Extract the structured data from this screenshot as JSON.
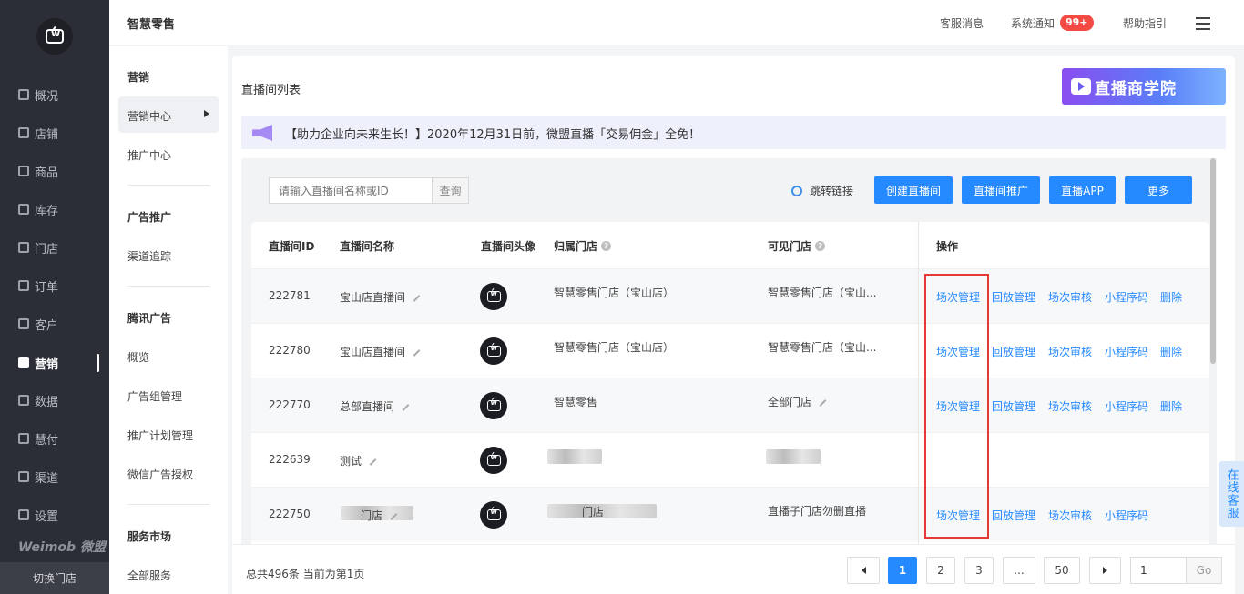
{
  "sidebar": {
    "items": [
      {
        "label": "概况",
        "icon": "overview-icon"
      },
      {
        "label": "店铺",
        "icon": "store-icon"
      },
      {
        "label": "商品",
        "icon": "goods-icon"
      },
      {
        "label": "库存",
        "icon": "inventory-icon"
      },
      {
        "label": "门店",
        "icon": "shop-icon"
      },
      {
        "label": "订单",
        "icon": "order-icon"
      },
      {
        "label": "客户",
        "icon": "customer-icon"
      },
      {
        "label": "营销",
        "icon": "marketing-icon",
        "active": true
      },
      {
        "label": "数据",
        "icon": "data-icon"
      },
      {
        "label": "慧付",
        "icon": "pay-icon"
      },
      {
        "label": "渠道",
        "icon": "channel-icon"
      },
      {
        "label": "设置",
        "icon": "settings-icon"
      }
    ],
    "brand": "Weimob 微盟",
    "switch_store": "切换门店"
  },
  "header": {
    "title": "智慧零售",
    "links": [
      "客服消息",
      "系统通知",
      "帮助指引"
    ],
    "badge": "99+"
  },
  "submenu": {
    "sections": [
      {
        "head": "营销",
        "items": [
          "营销中心",
          "推广中心"
        ]
      },
      {
        "head": "广告推广",
        "items": [
          "渠道追踪"
        ]
      },
      {
        "head": "腾讯广告",
        "items": [
          "概览",
          "广告组管理",
          "推广计划管理",
          "微信广告授权"
        ]
      },
      {
        "head": "服务市场",
        "items": [
          "全部服务"
        ]
      }
    ]
  },
  "main": {
    "title": "直播间列表",
    "banner_ad": "直播商学院",
    "notice": "【助力企业向未来生长！】2020年12月31日前，微盟直播「交易佣金」全免！",
    "search": {
      "placeholder": "请输入直播间名称或ID",
      "button": "查询"
    },
    "jump_link": "跳转链接",
    "buttons": [
      "创建直播间",
      "直播间推广",
      "直播APP",
      "更多"
    ],
    "columns": [
      "直播间ID",
      "直播间名称",
      "直播间头像",
      "归属门店",
      "可见门店",
      "操作"
    ],
    "rows": [
      {
        "id": "222781",
        "name": "宝山店直播间",
        "store": "智慧零售门店（宝山店）",
        "visible": "智慧零售门店（宝山...",
        "ops": [
          "场次管理",
          "回放管理",
          "场次审核",
          "小程序码",
          "删除"
        ]
      },
      {
        "id": "222780",
        "name": "宝山店直播间",
        "store": "智慧零售门店（宝山店）",
        "visible": "智慧零售门店（宝山...",
        "ops": [
          "场次管理",
          "回放管理",
          "场次审核",
          "小程序码",
          "删除"
        ]
      },
      {
        "id": "222770",
        "name": "总部直播间",
        "store": "智慧零售",
        "visible": "全部门店",
        "ops": [
          "场次管理",
          "回放管理",
          "场次审核",
          "小程序码",
          "删除"
        ]
      },
      {
        "id": "222639",
        "name": "测试",
        "store": "",
        "visible": "",
        "ops": []
      },
      {
        "id": "222750",
        "name": "门店",
        "store": "门店",
        "visible": "直播子门店勿删直播",
        "ops": [
          "场次管理",
          "回放管理",
          "场次审核",
          "小程序码"
        ]
      }
    ]
  },
  "pagination": {
    "summary": "总共496条 当前为第1页",
    "pages": [
      "1",
      "2",
      "3",
      "...",
      "50"
    ],
    "current": "1",
    "input_value": "1",
    "go": "Go"
  },
  "online_service": "在线客服",
  "colors": {
    "primary": "#2589ff",
    "sidebar": "#2b2e36",
    "badge": "#f44a44",
    "highlight": "#e53935"
  }
}
